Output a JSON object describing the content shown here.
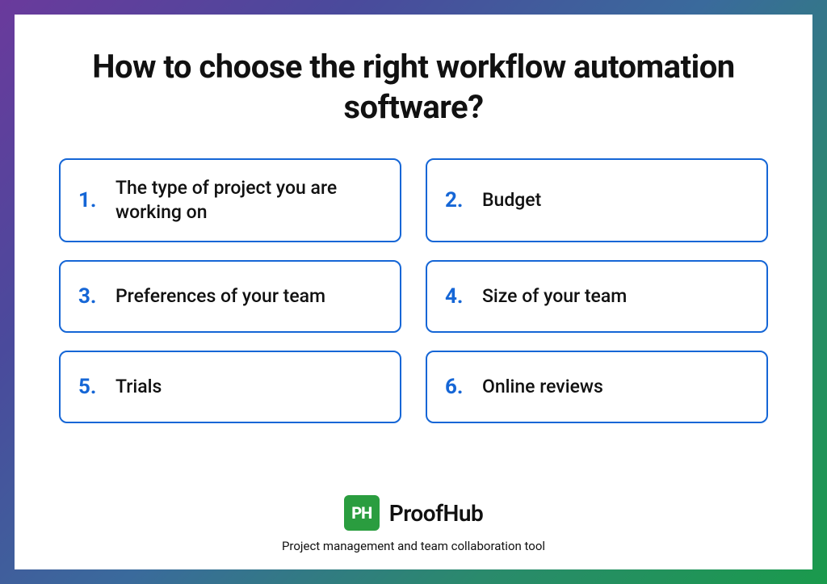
{
  "title": "How to choose the right workflow automation software?",
  "items": [
    {
      "num": "1.",
      "label": "The type of project you are working on"
    },
    {
      "num": "2.",
      "label": "Budget"
    },
    {
      "num": "3.",
      "label": "Preferences of your team"
    },
    {
      "num": "4.",
      "label": "Size of your team"
    },
    {
      "num": "5.",
      "label": "Trials"
    },
    {
      "num": "6.",
      "label": "Online reviews"
    }
  ],
  "brand": {
    "badge": "PH",
    "name": "ProofHub",
    "tagline": "Project management and team collaboration tool"
  }
}
